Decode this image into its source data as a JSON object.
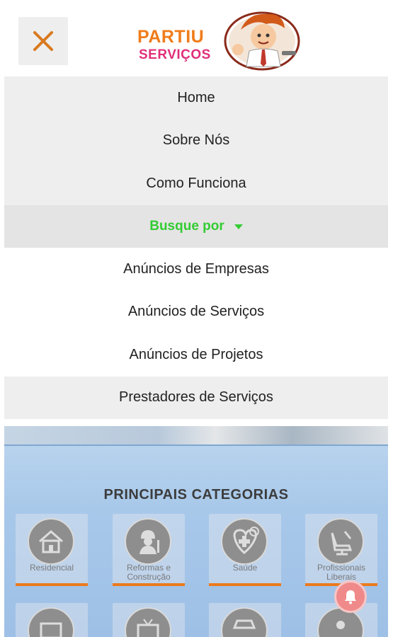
{
  "header": {
    "close_label": "close-icon",
    "logo_line1": "PARTIU",
    "logo_line2": "SERVIÇOS"
  },
  "menu": {
    "home": "Home",
    "about": "Sobre Nós",
    "how": "Como Funciona",
    "search_by": "Busque por",
    "companies": "Anúncios de Empresas",
    "services": "Anúncios de Serviços",
    "projects": "Anúncios de Projetos",
    "providers": "Prestadores de Serviços"
  },
  "categories": {
    "title": "PRINCIPAIS CATEGORIAS",
    "items": [
      {
        "label": "Residencial",
        "icon": "house-icon"
      },
      {
        "label": "Reformas e Construção",
        "icon": "worker-icon"
      },
      {
        "label": "Saúde",
        "icon": "health-icon"
      },
      {
        "label": "Profissionais Liberais",
        "icon": "dentist-chair-icon"
      }
    ]
  },
  "colors": {
    "accent_orange": "#f07c1a",
    "brand_pink": "#e0307a",
    "menu_green": "#33cc33",
    "category_bar": "#ec7a1c"
  }
}
